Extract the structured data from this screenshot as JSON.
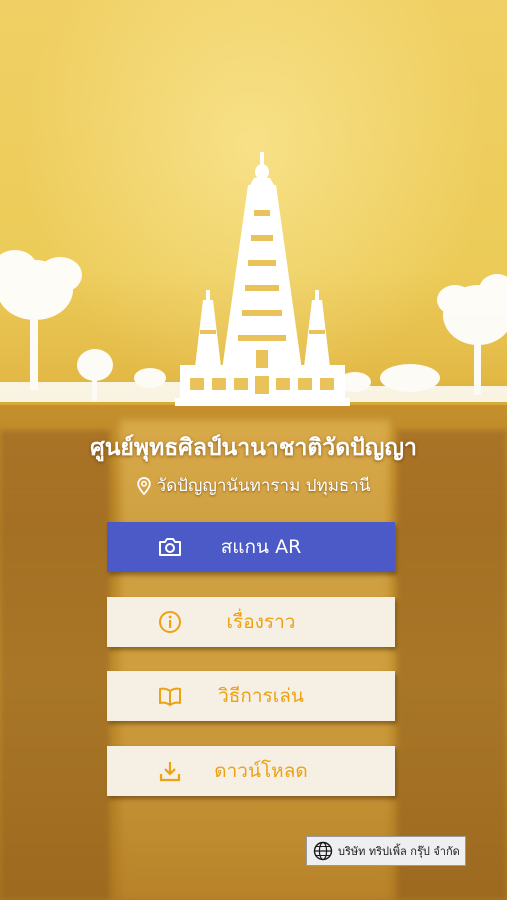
{
  "header": {
    "title": "ศูนย์พุทธศิลป์นานาชาติวัดปัญญา",
    "location": "วัดปัญญานันทาราม ปทุมธานี"
  },
  "menu": {
    "scan_ar": "สแกน AR",
    "story": "เรื่องราว",
    "how_to_play": "วิธีการเล่น",
    "download": "ดาวน์โหลด"
  },
  "footer": {
    "company": "บริษัท ทริปเพิ้ล กรุ๊ป จำกัด"
  },
  "icons": {
    "location": "map-pin-icon",
    "scan_ar": "camera-icon",
    "story": "info-circle-icon",
    "how_to_play": "open-book-icon",
    "download": "download-icon",
    "company": "globe-icon"
  },
  "colors": {
    "primary_button": "#4b5ac6",
    "light_button": "#f6efe3",
    "accent_text": "#eba214",
    "sky": "#eccb58"
  }
}
